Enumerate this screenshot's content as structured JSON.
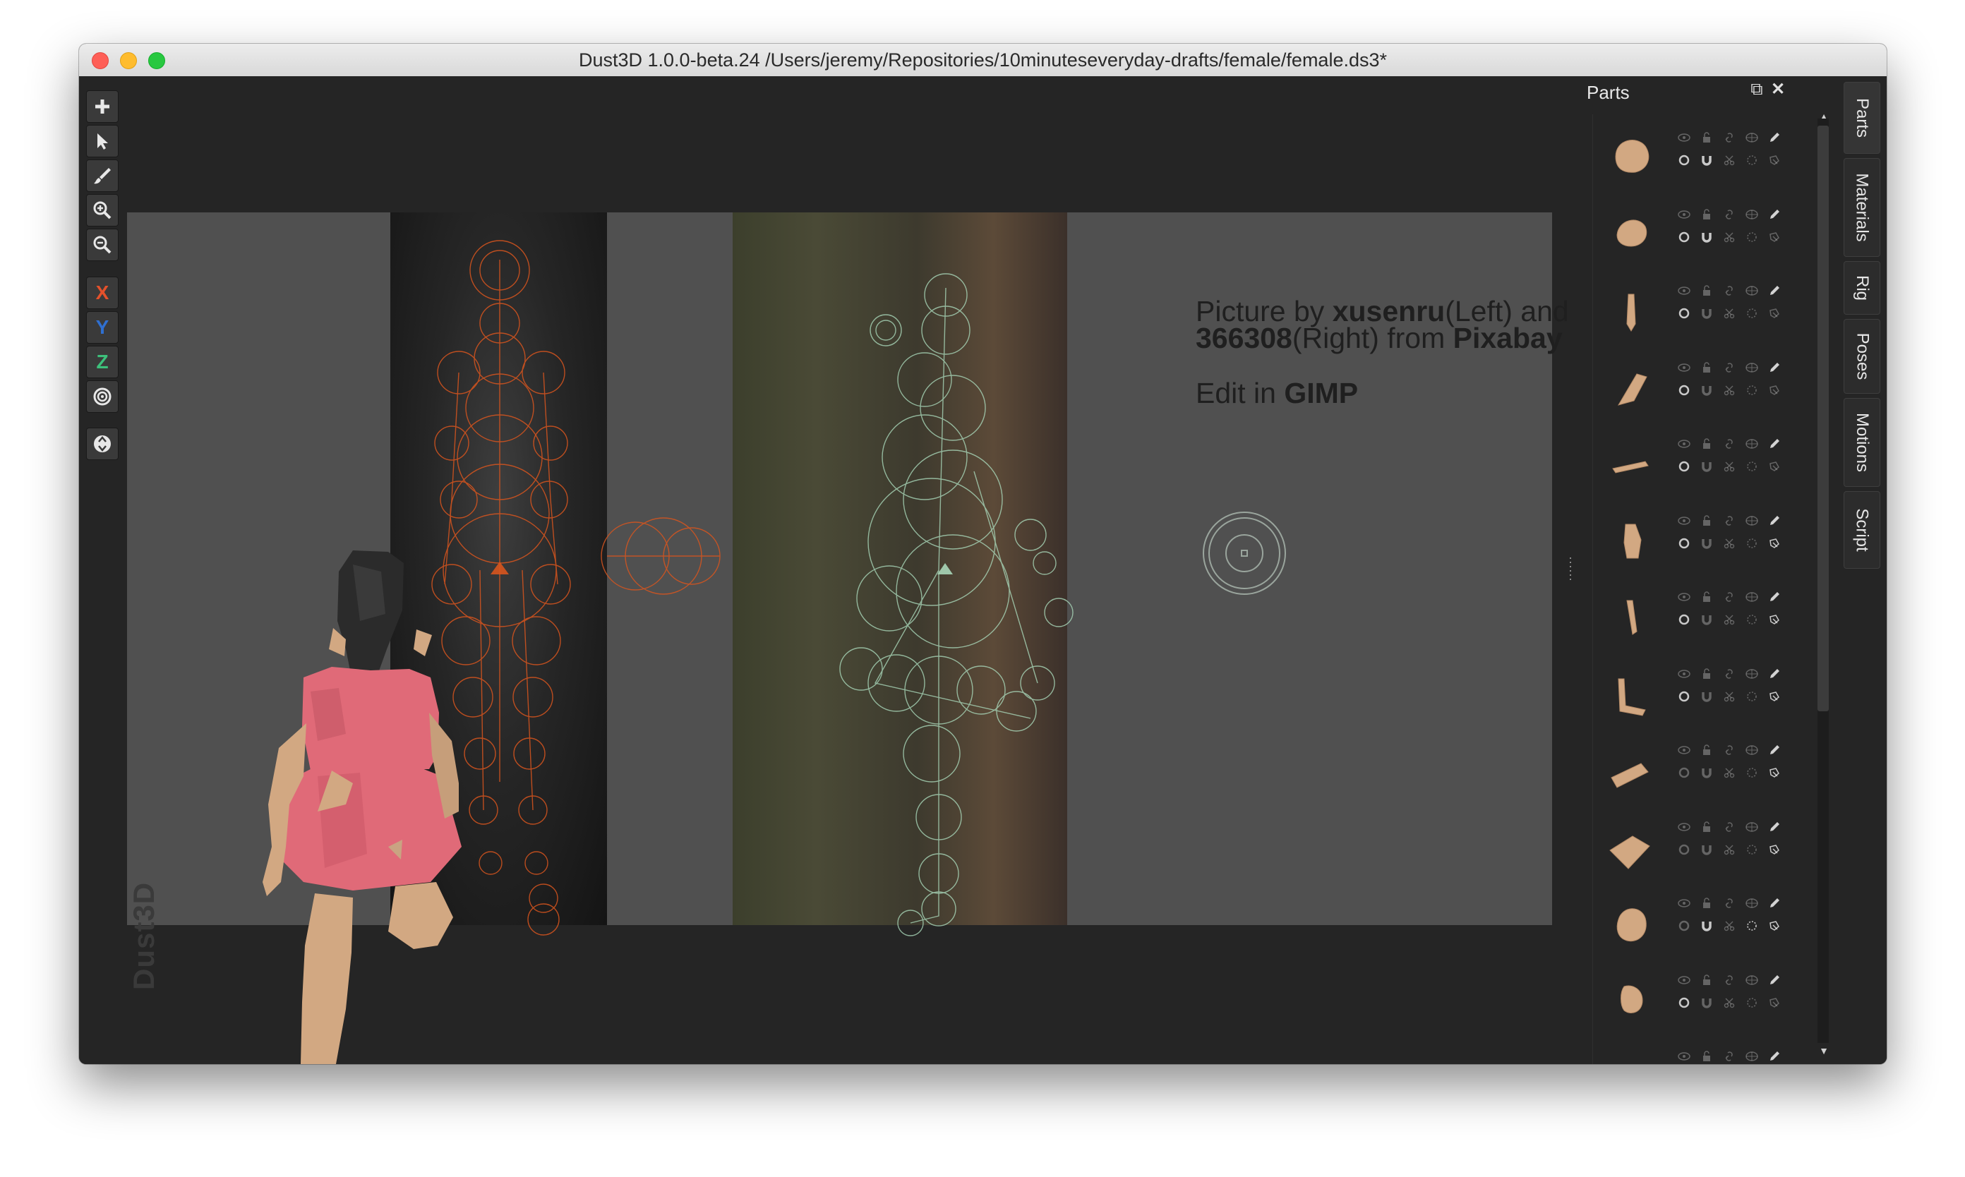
{
  "window": {
    "title": "Dust3D 1.0.0-beta.24 /Users/jeremy/Repositories/10minuteseveryday-drafts/female/female.ds3*"
  },
  "toolbar": {
    "tools": [
      {
        "name": "add-icon"
      },
      {
        "name": "select-arrow-icon"
      },
      {
        "name": "paint-brush-icon"
      },
      {
        "name": "zoom-in-icon"
      },
      {
        "name": "zoom-out-icon"
      },
      {
        "name": "x-axis-toggle",
        "label": "X",
        "color": "#e4512b"
      },
      {
        "name": "y-axis-toggle",
        "label": "Y",
        "color": "#2f6fd0"
      },
      {
        "name": "z-axis-toggle",
        "label": "Z",
        "color": "#3dc07b"
      },
      {
        "name": "radius-target-icon"
      },
      {
        "name": "recycle-icon"
      }
    ]
  },
  "canvas": {
    "credit": {
      "p1": "Picture by ",
      "author1": "xusenru",
      "p2": "(Left) and",
      "author2": "366308",
      "p3": "(Right) from ",
      "site": "Pixabay",
      "p4": "Edit in ",
      "tool": "GIMP"
    },
    "watermark": "Dust3D"
  },
  "parts_panel": {
    "title": "Parts",
    "float_icon": "float-window-icon",
    "close_icon": "close-icon",
    "parts_count_visible": 13
  },
  "side_tabs": [
    "Parts",
    "Materials",
    "Rig",
    "Poses",
    "Motions",
    "Script"
  ],
  "colors": {
    "skin": "#d2a882",
    "dress": "#e06a78",
    "hair": "#2b2b2b",
    "left_guides": "#d8551e",
    "right_guides": "#a8d6b8"
  }
}
